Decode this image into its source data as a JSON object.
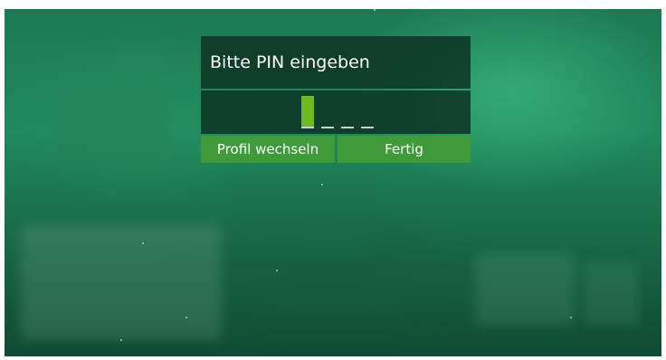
{
  "dialog": {
    "title": "Bitte PIN eingeben",
    "pin": {
      "entered_digits": 0,
      "total_digits": 4
    }
  },
  "buttons": {
    "switch_profile_label": "Profil wechseln",
    "done_label": "Fertig"
  },
  "colors": {
    "accent": "#6dbb1e",
    "button": "#3f9a3a",
    "panel": "#0c2e21"
  }
}
